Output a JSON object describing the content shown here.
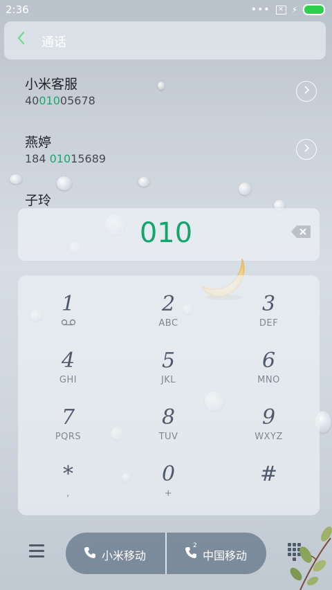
{
  "status": {
    "time": "2:36",
    "dots": "•••"
  },
  "header": {
    "title": "通话"
  },
  "contacts": [
    {
      "name": "小米客服",
      "num_pre": "40",
      "num_match": "010",
      "num_post": "05678"
    },
    {
      "name": "燕婷",
      "num_pre": "184 ",
      "num_match": "010",
      "num_post": "15689"
    },
    {
      "name": "子玲"
    }
  ],
  "dial": {
    "number": "010"
  },
  "keys": [
    {
      "digit": "1",
      "letters": ""
    },
    {
      "digit": "2",
      "letters": "ABC"
    },
    {
      "digit": "3",
      "letters": "DEF"
    },
    {
      "digit": "4",
      "letters": "GHI"
    },
    {
      "digit": "5",
      "letters": "JKL"
    },
    {
      "digit": "6",
      "letters": "MNO"
    },
    {
      "digit": "7",
      "letters": "PQRS"
    },
    {
      "digit": "8",
      "letters": "TUV"
    },
    {
      "digit": "9",
      "letters": "WXYZ"
    },
    {
      "digit": "*",
      "letters": ","
    },
    {
      "digit": "0",
      "letters": "+"
    },
    {
      "digit": "#",
      "letters": ""
    }
  ],
  "sim": [
    {
      "label": "小米移动",
      "badge": ""
    },
    {
      "label": "中国移动",
      "badge": "2"
    }
  ],
  "colors": {
    "accent": "#13a56b",
    "battery": "#2ecf4b",
    "keypad_digit": "#4e5a6c"
  },
  "icons": [
    "back-chevron-icon",
    "backspace-icon",
    "voicemail-icon",
    "menu-icon",
    "phone-icon",
    "dialpad-icon"
  ]
}
